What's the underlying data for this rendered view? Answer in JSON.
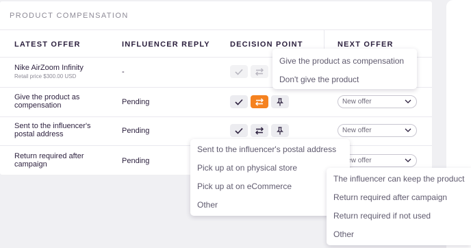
{
  "card": {
    "title": "PRODUCT COMPENSATION"
  },
  "headers": {
    "latest_offer": "LATEST OFFER",
    "influencer_reply": "INFLUENCER REPLY",
    "decision_point": "DECISION POINT",
    "next_offer": "NEXT OFFER"
  },
  "rows": [
    {
      "offer": "Nike AirZoom Infinity",
      "offer_sub": "Retail price  $300.00 USD",
      "reply": "-"
    },
    {
      "offer_line1": "Give the product as",
      "offer_line2": "compensation",
      "reply": "Pending",
      "next_offer": "New offer"
    },
    {
      "offer_line1": "Sent to the influencer's",
      "offer_line2": "postal address",
      "reply": "Pending",
      "next_offer": "New offer"
    },
    {
      "offer_line1": "Return required after",
      "offer_line2": "campaign",
      "reply": "Pending",
      "next_offer": "New offer"
    }
  ],
  "menus": {
    "compensation": [
      "Give the product as compensation",
      "Don't give the product"
    ],
    "delivery": [
      "Sent to the influencer's postal address",
      "Pick up at on physical store",
      "Pick up at on eCommerce",
      "Other"
    ],
    "return": [
      "The influencer can keep the product",
      "Return required after campaign",
      "Return required if not used",
      "Other"
    ]
  },
  "colors": {
    "accent": "#f58220",
    "text": "#2b1f3d",
    "muted": "#8d8a96"
  },
  "icons": [
    "check-icon",
    "swap-icon",
    "pin-icon",
    "chevron-down-icon"
  ]
}
